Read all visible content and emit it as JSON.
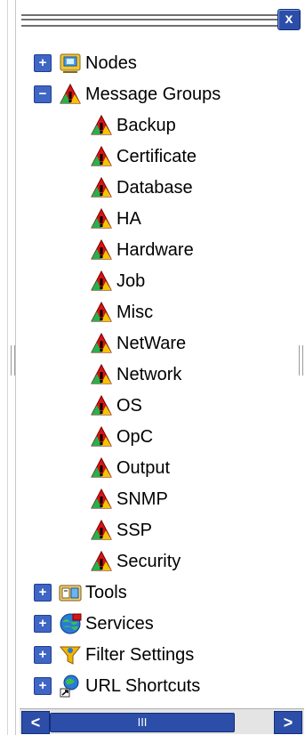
{
  "window": {
    "close_glyph": "x",
    "close_icon": "close-icon"
  },
  "tree": {
    "nodes": {
      "label": "Nodes",
      "expander": "+",
      "icon": "nodes-icon"
    },
    "message_groups": {
      "label": "Message Groups",
      "expander": "−",
      "icon": "message-group-warning-icon",
      "children": [
        {
          "label": "Backup",
          "icon": "message-group-warning-icon"
        },
        {
          "label": "Certificate",
          "icon": "message-group-warning-icon"
        },
        {
          "label": "Database",
          "icon": "message-group-warning-icon"
        },
        {
          "label": "HA",
          "icon": "message-group-warning-icon"
        },
        {
          "label": "Hardware",
          "icon": "message-group-warning-icon"
        },
        {
          "label": "Job",
          "icon": "message-group-warning-icon"
        },
        {
          "label": "Misc",
          "icon": "message-group-warning-icon"
        },
        {
          "label": "NetWare",
          "icon": "message-group-warning-icon"
        },
        {
          "label": "Network",
          "icon": "message-group-warning-icon"
        },
        {
          "label": "OS",
          "icon": "message-group-warning-icon"
        },
        {
          "label": "OpC",
          "icon": "message-group-warning-icon"
        },
        {
          "label": "Output",
          "icon": "message-group-warning-icon"
        },
        {
          "label": "SNMP",
          "icon": "message-group-warning-icon"
        },
        {
          "label": "SSP",
          "icon": "message-group-warning-icon"
        },
        {
          "label": "Security",
          "icon": "message-group-warning-icon"
        }
      ]
    },
    "tools": {
      "label": "Tools",
      "expander": "+",
      "icon": "tools-icon"
    },
    "services": {
      "label": "Services",
      "expander": "+",
      "icon": "services-icon"
    },
    "filter_settings": {
      "label": "Filter Settings",
      "expander": "+",
      "icon": "filter-icon"
    },
    "url_shortcuts": {
      "label": "URL Shortcuts",
      "expander": "+",
      "icon": "url-shortcuts-icon"
    }
  },
  "scrollbar": {
    "left_glyph": "<",
    "right_glyph": ">",
    "thumb_glyph": "III"
  },
  "colors": {
    "accent": "#2c4ea8",
    "warning": "#f2c500",
    "critical": "#d61414",
    "normal": "#22b34a"
  }
}
